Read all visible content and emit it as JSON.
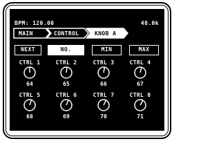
{
  "header": {
    "bpm": "BPM: 120.00",
    "sample_rate": "48.0k"
  },
  "breadcrumb": [
    "MAIN",
    "CONTROL",
    "KNOB A"
  ],
  "buttons": {
    "next": "NEXT",
    "no": "NO.",
    "min": "MIN",
    "max": "MAX"
  },
  "knobs": [
    {
      "label": "CTRL 1",
      "value": "64"
    },
    {
      "label": "CTRL 2",
      "value": "65"
    },
    {
      "label": "CTRL 3",
      "value": "66"
    },
    {
      "label": "CTRL 4",
      "value": "67"
    },
    {
      "label": "CTRL 5",
      "value": "68"
    },
    {
      "label": "CTRL 6",
      "value": "69"
    },
    {
      "label": "CTRL 7",
      "value": "70"
    },
    {
      "label": "CTRL 8",
      "value": "71"
    }
  ]
}
